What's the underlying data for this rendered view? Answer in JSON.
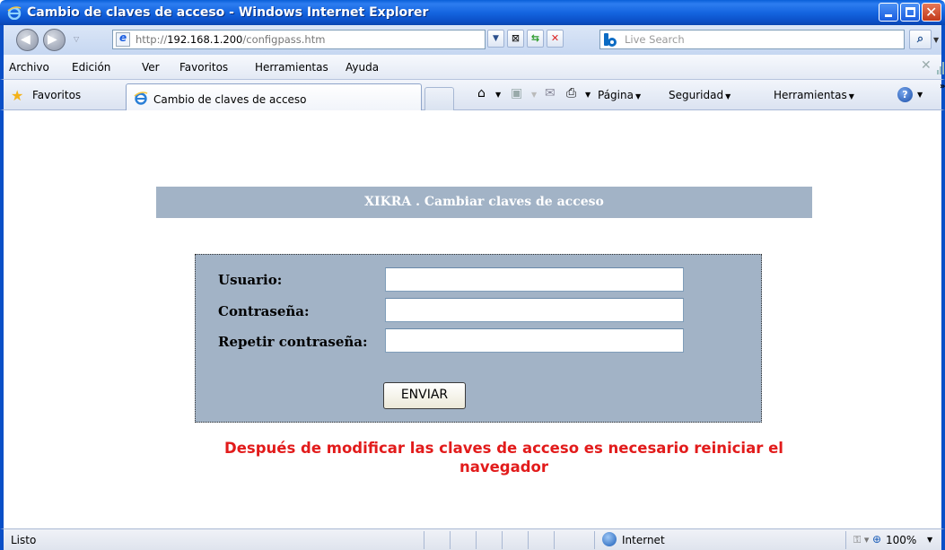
{
  "window": {
    "title": "Cambio de claves de acceso - Windows Internet Explorer"
  },
  "address": {
    "url_prefix": "http://",
    "url_host": "192.168.1.200",
    "url_path": "/configpass.htm",
    "search_placeholder": "Live Search"
  },
  "menu": {
    "items": [
      "Archivo",
      "Edición",
      "Ver",
      "Favoritos",
      "Herramientas",
      "Ayuda"
    ]
  },
  "favorites_bar": {
    "favorites_label": "Favoritos",
    "tab_label": "Cambio de claves de acceso",
    "commands": {
      "page": "Página",
      "security": "Seguridad",
      "tools": "Herramientas"
    }
  },
  "page": {
    "header": "XIKRA . Cambiar claves de acceso",
    "form": {
      "user_label": "Usuario:",
      "password_label": "Contraseña:",
      "repeat_label": "Repetir contraseña:",
      "user_value": "",
      "password_value": "",
      "repeat_value": "",
      "submit_label": "ENVIAR"
    },
    "notice": "Después de modificar las claves de acceso es necesario reiniciar el navegador"
  },
  "status": {
    "text": "Listo",
    "zone": "Internet",
    "zoom": "100%"
  },
  "colors": {
    "panel": "#a2b3c6",
    "notice": "#e21b1b",
    "titlebar": "#0a5fd8"
  }
}
